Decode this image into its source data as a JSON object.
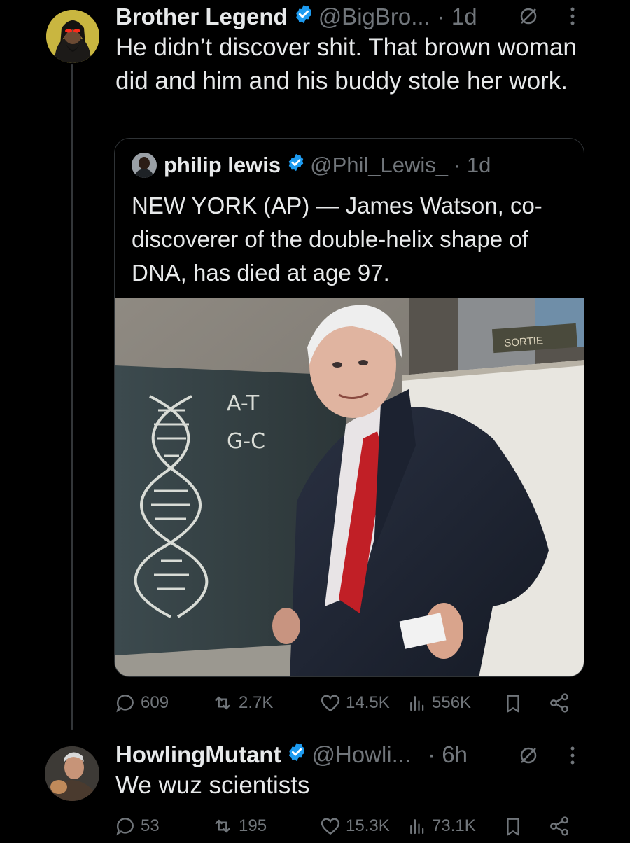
{
  "colors": {
    "accent": "#1d9bf0",
    "muted": "#71767b",
    "text": "#e7e9ea",
    "background": "#000000"
  },
  "tweet1": {
    "name": "Brother Legend",
    "handle": "@BigBro...",
    "time": "· 1d",
    "text": "He didn’t discover shit. That brown woman did and him and his buddy stole her work.",
    "quote": {
      "name": "philip lewis",
      "handle": "@Phil_Lewis_",
      "time": "· 1d",
      "text": "NEW YORK (AP) — James Watson, co-discoverer of the double-helix shape of DNA, has died at age 97.",
      "image": {
        "chalk_top": "A-T",
        "chalk_bottom": "G-C",
        "sign": "SORTIE"
      }
    },
    "actions": {
      "replies": "609",
      "reposts": "2.7K",
      "likes": "14.5K",
      "views": "556K"
    }
  },
  "tweet2": {
    "name": "HowlingMutant",
    "handle": "@Howli...",
    "time": "· 6h",
    "text": "We wuz scientists",
    "actions": {
      "replies": "53",
      "reposts": "195",
      "likes": "15.3K",
      "views": "73.1K"
    }
  }
}
